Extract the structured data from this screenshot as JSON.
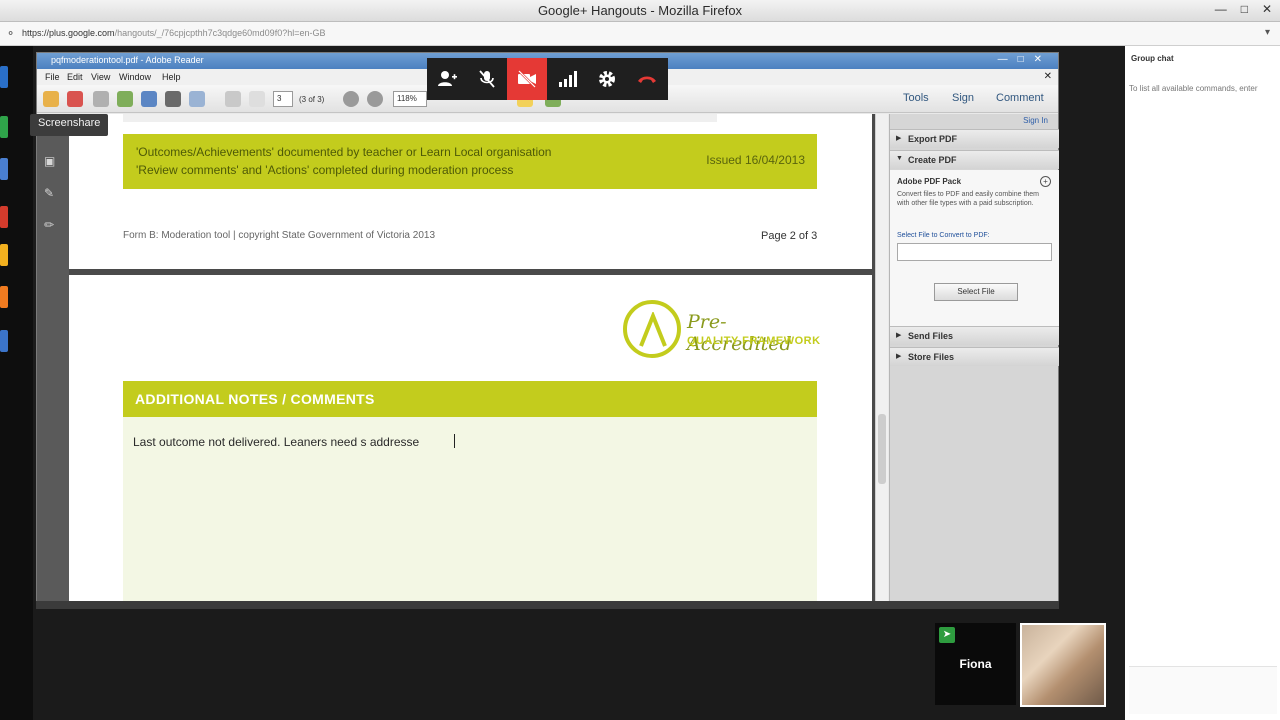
{
  "browser": {
    "title": "Google+ Hangouts - Mozilla Firefox",
    "url_host": "https://plus.google.com",
    "url_path": "/hangouts/_/76cpjcpthh7c3qdge60md09f0?hl=en-GB"
  },
  "screenshare_tooltip": "Screenshare",
  "adobe": {
    "title": "pqfmoderationtool.pdf - Adobe Reader",
    "menu": [
      "File",
      "Edit",
      "View",
      "Window",
      "Help"
    ],
    "page_input": "3",
    "page_of": "(3 of 3)",
    "zoom": "118%",
    "tabs": {
      "tools": "Tools",
      "sign": "Sign",
      "comment": "Comment"
    }
  },
  "doc": {
    "band_line1": "'Outcomes/Achievements' documented by teacher or Learn Local organisation",
    "band_line2": "'Review comments' and 'Actions' completed during moderation process",
    "issued": "Issued 16/04/2013",
    "footer_left": "Form B: Moderation tool  |  copyright State Government of Victoria 2013",
    "footer_right": "Page 2 of 3",
    "logo_line1": "Pre-Accredited",
    "logo_line2": "QUALITY FRAMEWORK",
    "notes_header": "ADDITIONAL NOTES / COMMENTS",
    "notes_text": "Last outcome not delivered. Leaners need s addresse"
  },
  "tools_pane": {
    "sign_in": "Sign In",
    "export_pdf": "Export PDF",
    "create_pdf": "Create PDF",
    "pack_title": "Adobe PDF Pack",
    "pack_desc": "Convert files to PDF and easily combine them with other file types with a paid subscription.",
    "select_label": "Select File to Convert to PDF:",
    "select_button": "Select File",
    "send_files": "Send Files",
    "store_files": "Store Files"
  },
  "chat": {
    "header": "Group chat",
    "hint": "To list all available commands, enter"
  },
  "participants": {
    "fiona": "Fiona"
  },
  "colors": {
    "accent_lime": "#c3cc1d",
    "hangup_red": "#e53935",
    "video_off_red": "#e53935"
  }
}
